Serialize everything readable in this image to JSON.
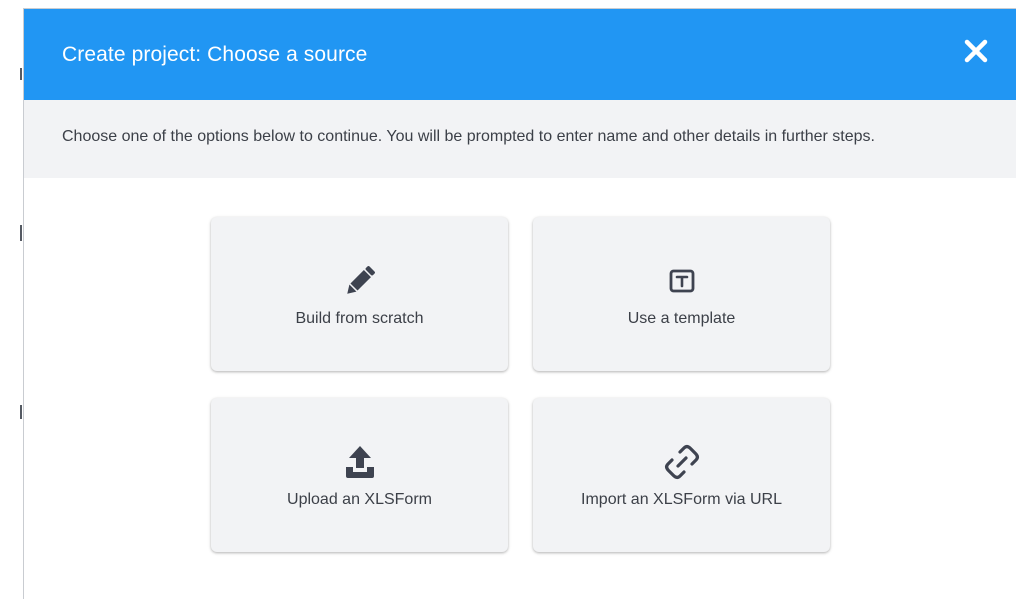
{
  "dialog": {
    "title": "Create project: Choose a source",
    "close_icon": "close-icon",
    "instructions": "Choose one of the options below to continue. You will be prompted to enter name and other details in further steps.",
    "header_color": "#2196f3",
    "subheader_color": "#f2f3f5"
  },
  "options": [
    {
      "label": "Build from scratch",
      "icon": "pencil-icon"
    },
    {
      "label": "Use a template",
      "icon": "template-icon"
    },
    {
      "label": "Upload an XLSForm",
      "icon": "upload-icon"
    },
    {
      "label": "Import an XLSForm via URL",
      "icon": "link-icon"
    }
  ],
  "colors": {
    "icon": "#3e4350",
    "text": "#3c4048",
    "card": "#f2f3f5"
  }
}
